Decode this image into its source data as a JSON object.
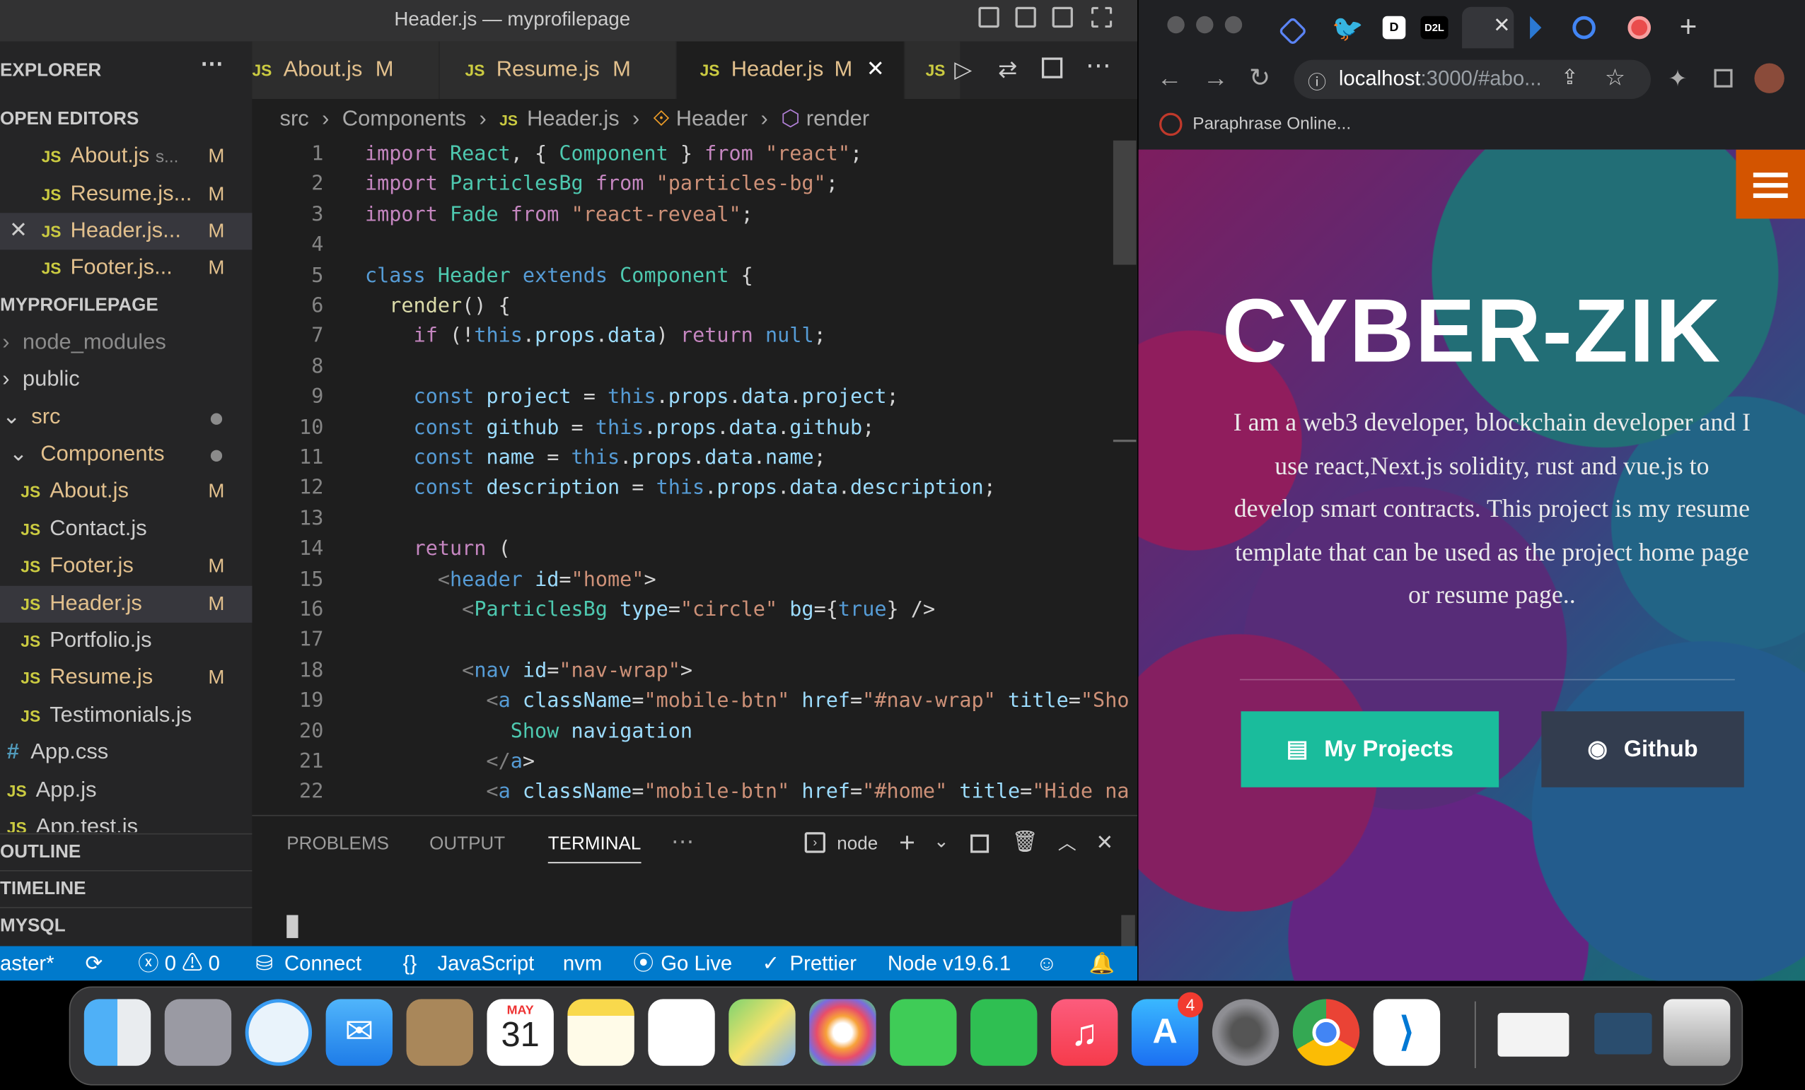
{
  "vscode": {
    "window_title": "Header.js — myprofilepage",
    "explorer": {
      "header": "EXPLORER",
      "open_editors_header": "OPEN EDITORS",
      "open_editors": [
        {
          "name": "About.js",
          "suffix": "s...",
          "mark": "M"
        },
        {
          "name": "Resume.js...",
          "mark": "M"
        },
        {
          "name": "Header.js...",
          "mark": "M"
        },
        {
          "name": "Footer.js...",
          "mark": "M"
        }
      ],
      "project_header": "MYPROFILEPAGE",
      "tree": [
        {
          "name": "node_modules"
        },
        {
          "name": "public"
        },
        {
          "name": "src"
        },
        {
          "name": "Components"
        },
        {
          "name": "About.js",
          "mark": "M"
        },
        {
          "name": "Contact.js"
        },
        {
          "name": "Footer.js",
          "mark": "M"
        },
        {
          "name": "Header.js",
          "mark": "M"
        },
        {
          "name": "Portfolio.js"
        },
        {
          "name": "Resume.js",
          "mark": "M"
        },
        {
          "name": "Testimonials.js"
        },
        {
          "name": "App.css"
        },
        {
          "name": "App.js"
        },
        {
          "name": "App.test.js"
        }
      ],
      "outline": "OUTLINE",
      "timeline": "TIMELINE",
      "mysql": "MYSQL"
    },
    "tabs": [
      {
        "name": "About.js",
        "mark": "M"
      },
      {
        "name": "Resume.js",
        "mark": "M"
      },
      {
        "name": "Header.js",
        "mark": "M"
      }
    ],
    "breadcrumb": [
      "src",
      "Components",
      "Header.js",
      "Header",
      "render"
    ],
    "code_lines": [
      "import React, { Component } from \"react\";",
      "import ParticlesBg from \"particles-bg\";",
      "import Fade from \"react-reveal\";",
      "",
      "class Header extends Component {",
      "  render() {",
      "    if (!this.props.data) return null;",
      "",
      "    const project = this.props.data.project;",
      "    const github = this.props.data.github;",
      "    const name = this.props.data.name;",
      "    const description = this.props.data.description;",
      "",
      "    return (",
      "      <header id=\"home\">",
      "        <ParticlesBg type=\"circle\" bg={true} />",
      "",
      "        <nav id=\"nav-wrap\">",
      "          <a className=\"mobile-btn\" href=\"#nav-wrap\" title=\"Sho",
      "            Show navigation",
      "          </a>",
      "          <a className=\"mobile-btn\" href=\"#home\" title=\"Hide na"
    ],
    "panel_tabs": [
      "PROBLEMS",
      "OUTPUT",
      "TERMINAL"
    ],
    "terminal_name": "node",
    "status": {
      "branch": "aster*",
      "errors": "0",
      "warnings": "0",
      "connect": "Connect",
      "language": "JavaScript",
      "nvm": "nvm",
      "golive": "Go Live",
      "prettier": "Prettier",
      "node": "Node v19.6.1"
    }
  },
  "chrome": {
    "url_host": "localhost",
    "url_rest": ":3000/#abo...",
    "bookmark": "Paraphrase Online...",
    "page": {
      "title": "CYBER-ZIK",
      "description": "I am a web3 developer, blockchain developer and I use react,Next.js solidity, rust and vue.js to develop smart contracts. This project is my resume template that can be used as the project home page or resume page..",
      "btn_projects": "My Projects",
      "btn_github": "Github"
    }
  },
  "dock": {
    "calendar_month": "MAY",
    "calendar_day": "31",
    "appstore_badge": "4"
  },
  "colors": {
    "statusbar": "#007acc",
    "projects_btn": "#1abc9c",
    "github_btn": "#333d4f",
    "menu_btn": "#d35400"
  }
}
